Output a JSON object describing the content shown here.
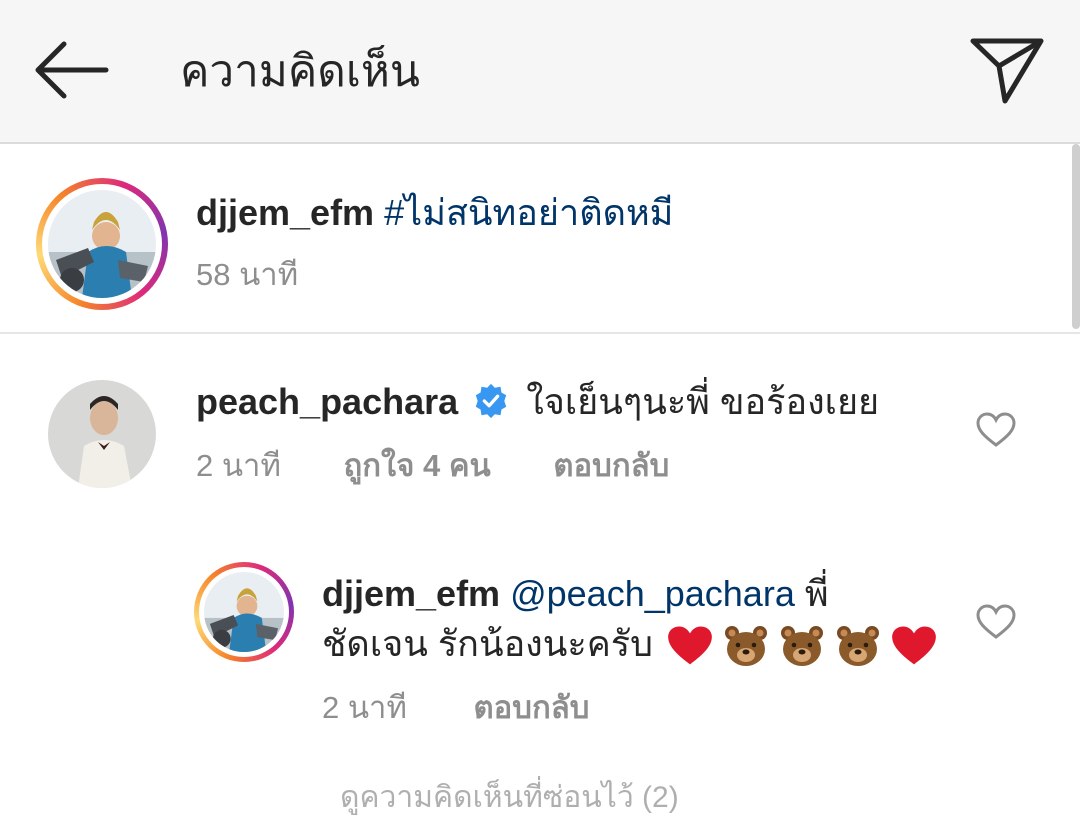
{
  "header": {
    "title": "ความคิดเห็น",
    "back_icon": "arrow-left-icon",
    "share_icon": "paper-plane-icon"
  },
  "caption": {
    "username": "djjem_efm",
    "hashtag": "#ไม่สนิทอย่าติดหมี",
    "time": "58 นาที"
  },
  "comments": [
    {
      "username": "peach_pachara",
      "verified": true,
      "text": "ใจเย็นๆนะพี่ ขอร้องเยย",
      "time": "2 นาที",
      "likes": "ถูกใจ 4 คน",
      "reply_label": "ตอบกลับ"
    }
  ],
  "reply": {
    "username": "djjem_efm",
    "mention": "@peach_pachara",
    "text_line1_tail": "พี่",
    "text_line2": "ชัดเจน รักน้องนะครับ",
    "emojis": [
      "heart",
      "bear",
      "bear",
      "bear",
      "heart"
    ],
    "time": "2 นาที",
    "reply_label": "ตอบกลับ"
  },
  "footer_partial": "ดูความคิดเห็นที่ซ่อนไว้ (2)",
  "colors": {
    "accent_link": "#003569",
    "verified_blue": "#3897f0",
    "meta_gray": "#8e8e8e",
    "heart_red": "#e0182d",
    "bear_brown": "#8b5a2b"
  }
}
